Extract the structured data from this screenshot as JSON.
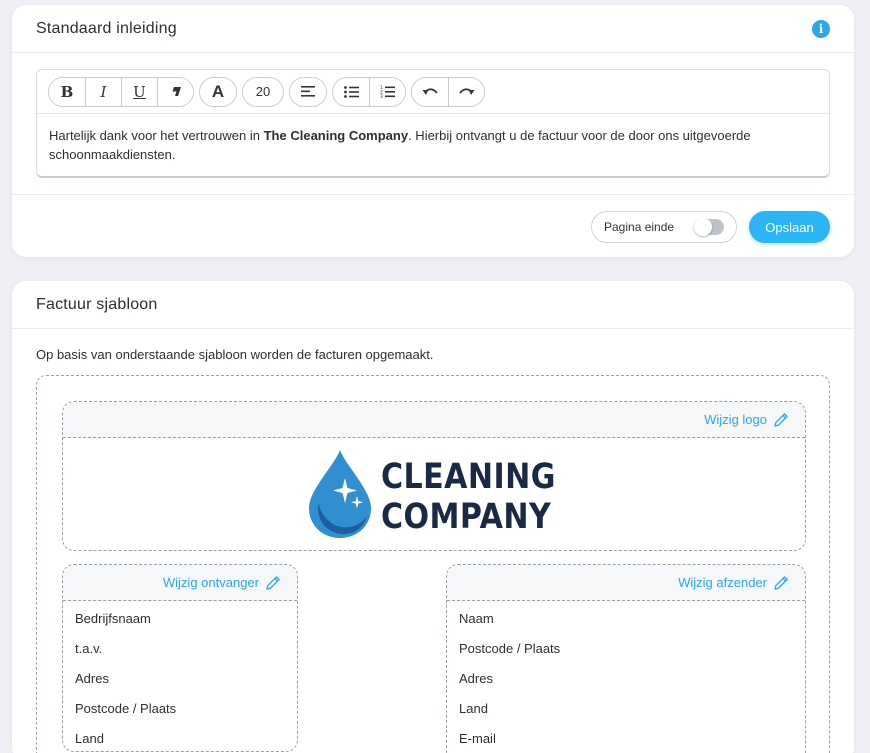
{
  "intro_card": {
    "title": "Standaard inleiding",
    "toolbar": {
      "bold": "B",
      "italic": "I",
      "underline": "U",
      "font_color": "A",
      "font_size": "20"
    },
    "content_before": "Hartelijk dank voor het vertrouwen in ",
    "content_company": "The Cleaning Company",
    "content_after": ". Hierbij ontvangt u de factuur voor de door ons uitgevoerde schoonmaakdiensten.",
    "page_end_label": "Pagina einde",
    "page_end_enabled": false,
    "save_label": "Opslaan"
  },
  "template_card": {
    "title": "Factuur sjabloon",
    "intro": "Op basis van onderstaande sjabloon worden de facturen opgemaakt.",
    "logo": {
      "edit_label": "Wijzig logo",
      "line1": "CLEANING",
      "line2": "COMPANY"
    },
    "recipient": {
      "edit_label": "Wijzig ontvanger",
      "lines": [
        "Bedrijfsnaam",
        "t.a.v.",
        "Adres",
        "Postcode / Plaats",
        "Land"
      ]
    },
    "sender": {
      "edit_label": "Wijzig afzender",
      "lines": [
        "Naam",
        "Postcode / Plaats",
        "Adres",
        "Land",
        "E-mail"
      ]
    }
  },
  "colors": {
    "accent": "#2ab6f5",
    "link": "#2aa7e8",
    "logo_drop": "#2f8fcf",
    "logo_text": "#1b2a44"
  }
}
